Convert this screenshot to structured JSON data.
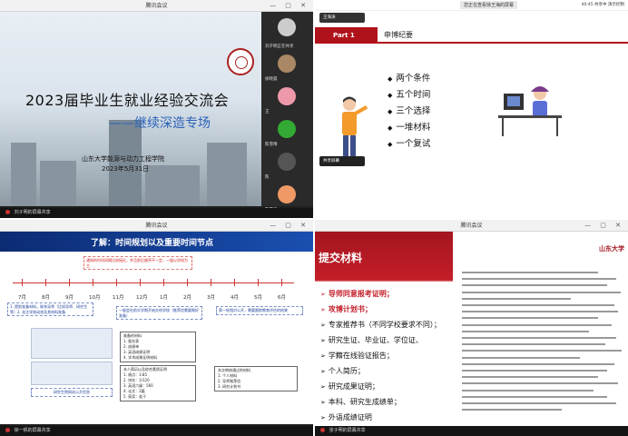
{
  "pane1": {
    "window_title": "腾讯会议",
    "slide": {
      "title": "2023届毕业生就业经验交流会",
      "subtitle": "——继续深造专场",
      "org": "山东大学能源与动力工程学院",
      "date": "2023年5月31日"
    },
    "participants": [
      {
        "name": "刘子明",
        "color": "#ccc"
      },
      {
        "name": "刘子明正在共享",
        "color": "#5b8bd6"
      },
      {
        "name": "徐晓晨",
        "color": "#a86"
      },
      {
        "name": "王",
        "color": "#e9a"
      },
      {
        "name": "陈雪晴",
        "color": "#3a3"
      },
      {
        "name": "陈",
        "color": "#555"
      },
      {
        "name": "陈雪晴",
        "color": "#e96"
      }
    ],
    "status": "刘子明的屏幕共享"
  },
  "pane2": {
    "window_title": "您正在查看徐王海的屏幕",
    "status_right": "40:45 共享中  演示控制",
    "part_label": "Part 1",
    "section_title": "申博纪要",
    "bullets": [
      "两个条件",
      "五个时间",
      "三个选择",
      "一堆材料",
      "一个复试"
    ],
    "cam_top": "王海涛",
    "cam_bottom": "共享屏幕"
  },
  "pane3": {
    "window_title": "腾讯会议",
    "header": "了解：时间规划以及重要时间节点",
    "months": [
      "7月",
      "8月",
      "9月",
      "10月",
      "11月",
      "12月",
      "1月",
      "2月",
      "3月",
      "4月",
      "5月",
      "6月"
    ],
    "note_red": "通知的时间间隔比较接近，并且前后顺序不一定，一般以学校为主",
    "note_left": "1. 提前准备材料，联系导师（比如导师、研究生等）2. 关注学校动态及其材料准备",
    "note_mid": "一般会在前半学期开始交给学校（推荐信需要做好准备）",
    "note_right": "第一轮相对公开，需要跟踪教育评估的结果",
    "block1_title": "准备的材料",
    "block1_lines": [
      "1. 报名表",
      "2. 成绩单",
      "3. 英语成绩证明",
      "4. 学术成果证明材料"
    ],
    "block2_title": "本人简历以及综合素质证明",
    "block2_lines": [
      "1. 绩点：3.85",
      "2. 排名：1/120",
      "3. 英语六级：560",
      "4. 论文：2篇",
      "5. 获奖：若干"
    ],
    "block3_title": "本次审核通过的材料",
    "block3_lines": [
      "1. 个人材料",
      "2. 导师推荐信",
      "3. 研究计划书"
    ],
    "screenshot_caption": "研究生院网站公开信息",
    "status": "徐一帆的屏幕共享"
  },
  "pane4": {
    "window_title": "腾讯会议",
    "heading": "提交材料",
    "items": [
      {
        "text": "导师同意报考证明；",
        "red": true
      },
      {
        "text": "攻博计划书；",
        "red": true
      },
      {
        "text": "专家推荐书（不同学校要求不同）；",
        "red": false
      },
      {
        "text": "研究生证、毕业证、学位证、",
        "red": false
      },
      {
        "text": "学籍在线验证报告；",
        "red": false
      },
      {
        "text": "个人简历；",
        "red": false
      },
      {
        "text": "研究成果证明；",
        "red": false
      },
      {
        "text": "本科、研究生成绩单；",
        "red": false
      },
      {
        "text": "外语成绩证明",
        "red": false
      },
      {
        "text": "……",
        "red": false
      }
    ],
    "logo": "山东大学",
    "status": "张子明的屏幕共享"
  }
}
